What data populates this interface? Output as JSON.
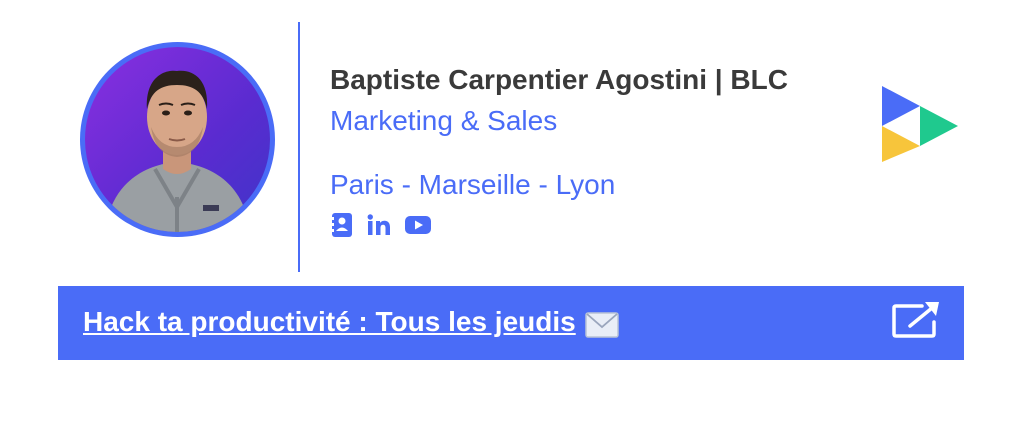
{
  "profile": {
    "name": "Baptiste Carpentier Agostini | BLC",
    "role": "Marketing & Sales",
    "location": "Paris - Marseille - Lyon"
  },
  "socials": [
    {
      "icon": "contact-book-icon",
      "label": "Contact"
    },
    {
      "icon": "linkedin-icon",
      "label": "in"
    },
    {
      "icon": "youtube-icon",
      "label": "YouTube"
    }
  ],
  "banner": {
    "text": "Hack ta productivité : Tous les jeudis ",
    "emoji_icon": "envelope-icon",
    "action_icon": "open-external-icon"
  },
  "colors": {
    "accent": "#4a6cf7",
    "name_text": "#3a3a3a",
    "logo_blue": "#4a6cf7",
    "logo_green": "#1fc98e",
    "logo_yellow": "#f7c53b"
  }
}
